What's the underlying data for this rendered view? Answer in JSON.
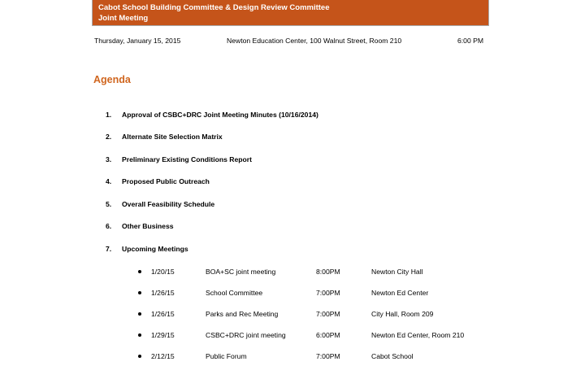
{
  "banner": {
    "title_line1": "Cabot School Building Committee & Design Review Committee",
    "title_line2": "Joint Meeting",
    "color": "#c5541a"
  },
  "meta": {
    "date": "Thursday, January 15, 2015",
    "location": "Newton Education Center, 100 Walnut Street, Room 210",
    "time": "6:00 PM"
  },
  "agenda": {
    "heading": "Agenda",
    "heading_color": "#d0661f",
    "items": [
      {
        "num": "1.",
        "text": "Approval of CSBC+DRC Joint Meeting Minutes (10/16/2014)"
      },
      {
        "num": "2.",
        "text": "Alternate Site Selection Matrix"
      },
      {
        "num": "3.",
        "text": "Preliminary Existing Conditions Report"
      },
      {
        "num": "4.",
        "text": "Proposed Public Outreach"
      },
      {
        "num": "5.",
        "text": "Overall Feasibility Schedule"
      },
      {
        "num": "6.",
        "text": "Other Business"
      },
      {
        "num": "7.",
        "text": "Upcoming Meetings"
      }
    ]
  },
  "meetings": [
    {
      "date": "1/20/15",
      "event": "BOA+SC joint meeting",
      "time": "8:00PM",
      "place": "Newton City Hall"
    },
    {
      "date": "1/26/15",
      "event": "School Committee",
      "time": "7:00PM",
      "place": "Newton Ed Center"
    },
    {
      "date": "1/26/15",
      "event": "Parks and Rec Meeting",
      "time": "7:00PM",
      "place": "City Hall, Room 209"
    },
    {
      "date": "1/29/15",
      "event": "CSBC+DRC joint meeting",
      "time": "6:00PM",
      "place": "Newton Ed Center, Room 210"
    },
    {
      "date": "2/12/15",
      "event": "Public Forum",
      "time": "7:00PM",
      "place": "Cabot School"
    }
  ]
}
